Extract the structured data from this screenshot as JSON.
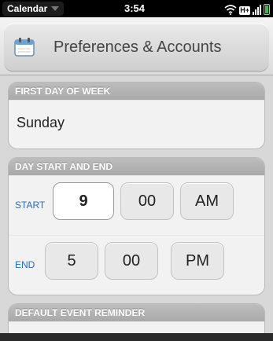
{
  "status_bar": {
    "app_name": "Calendar",
    "time": "3:54",
    "network": "H+"
  },
  "header": {
    "title": "Preferences & Accounts",
    "icon": "calendar-icon"
  },
  "first_day": {
    "header": "FIRST DAY OF WEEK",
    "value": "Sunday"
  },
  "day_start_end": {
    "header": "DAY START AND END",
    "start": {
      "label": "START",
      "hour": "9",
      "minute": "00",
      "ampm": "AM"
    },
    "end": {
      "label": "END",
      "hour": "5",
      "minute": "00",
      "ampm": "PM"
    }
  },
  "reminder": {
    "header": "DEFAULT EVENT REMINDER"
  },
  "colors": {
    "accent_label": "#2a6ab8",
    "group_header": "#a9a9a9",
    "battery": "#4caf50"
  }
}
